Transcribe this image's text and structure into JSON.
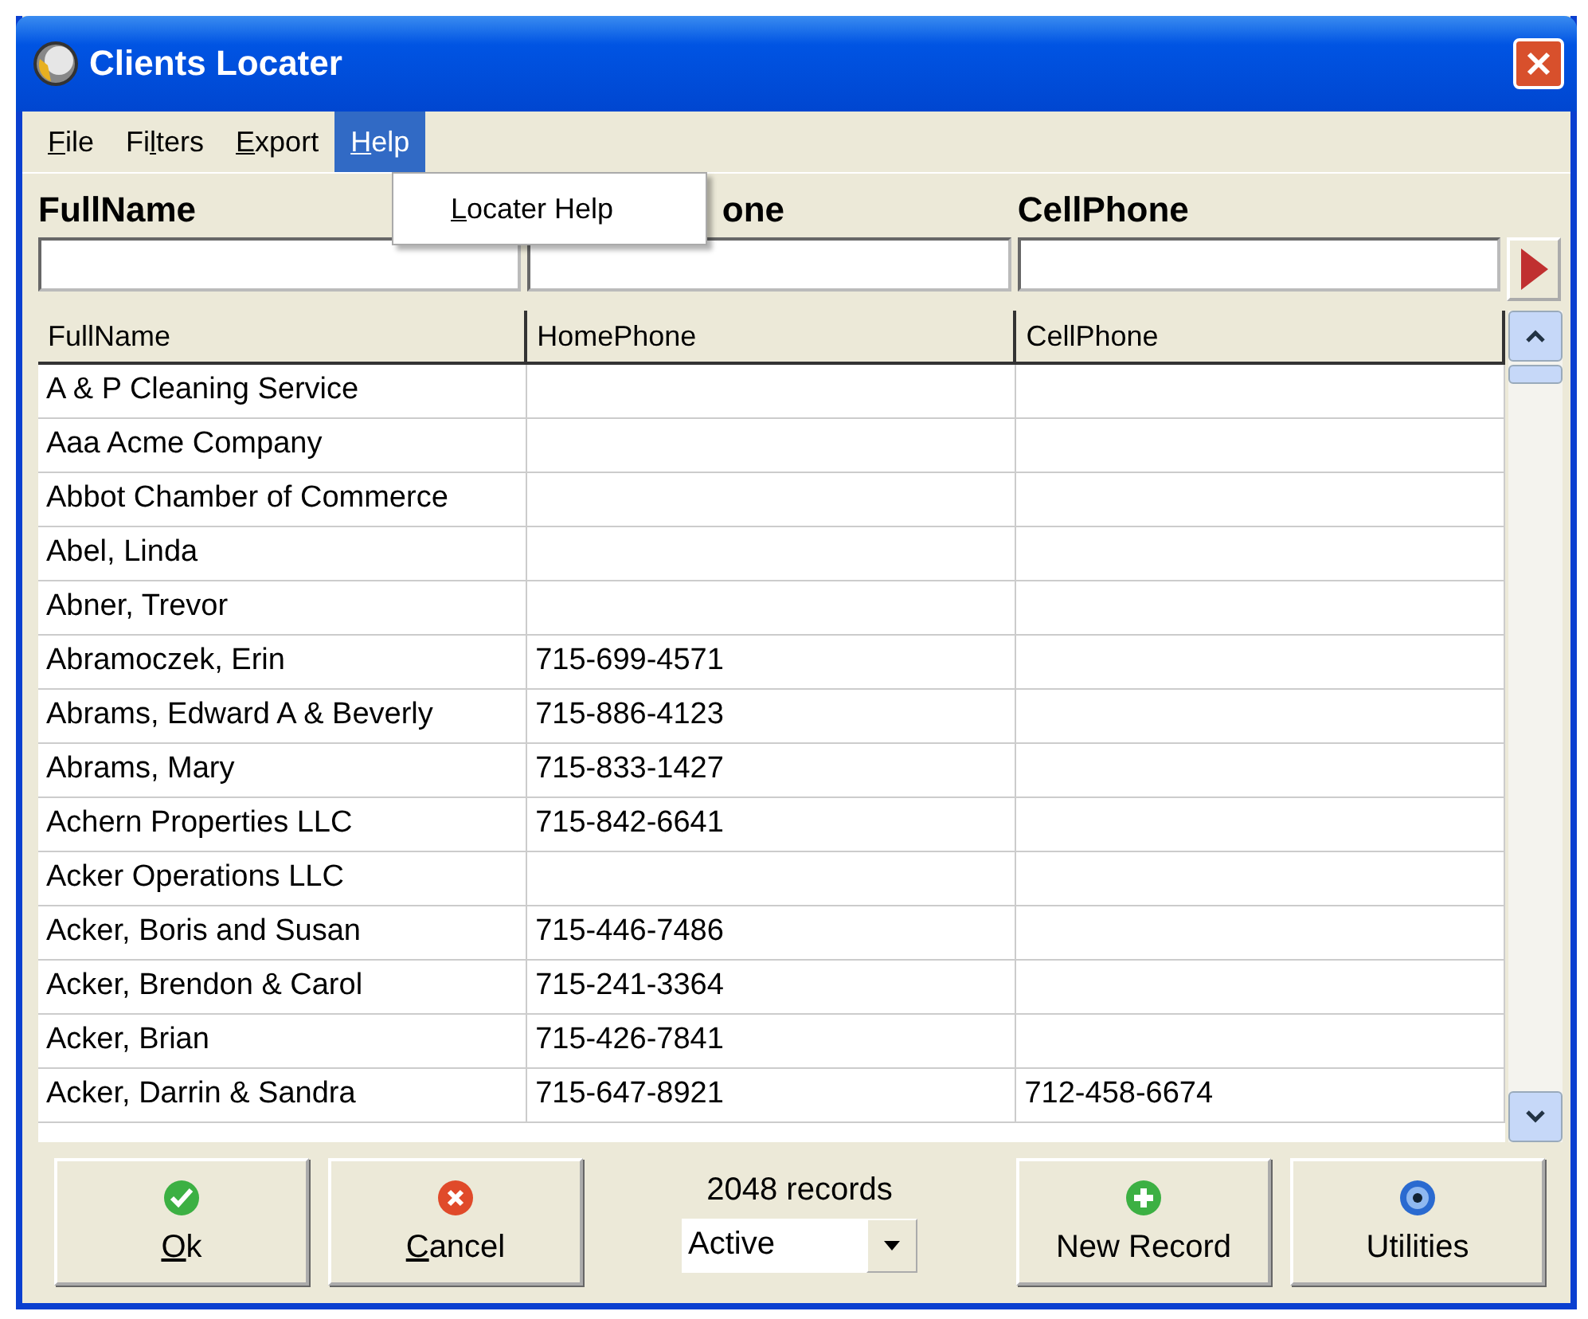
{
  "window": {
    "title": "Clients Locater"
  },
  "menu": [
    {
      "parts": {
        "key": "F",
        "post": "ile"
      },
      "selected": false
    },
    {
      "parts": {
        "pre": "Fi",
        "key": "l",
        "post": "ters"
      },
      "selected": false
    },
    {
      "parts": {
        "key": "E",
        "post": "xport"
      },
      "selected": false
    },
    {
      "parts": {
        "key": "H",
        "post": "elp"
      },
      "selected": true
    }
  ],
  "open_menu": {
    "items": [
      {
        "parts": {
          "key": "L",
          "post": "ocater Help"
        }
      }
    ]
  },
  "filters": [
    {
      "label": "FullName"
    },
    {
      "label": "one"
    },
    {
      "label": "CellPhone"
    }
  ],
  "table": {
    "columns": [
      "FullName",
      "HomePhone",
      "CellPhone"
    ],
    "rows": [
      [
        "A & P Cleaning Service",
        "",
        ""
      ],
      [
        "Aaa Acme Company",
        "",
        ""
      ],
      [
        "Abbot Chamber of Commerce",
        "",
        ""
      ],
      [
        "Abel, Linda",
        "",
        ""
      ],
      [
        "Abner, Trevor",
        "",
        ""
      ],
      [
        "Abramoczek, Erin",
        "715-699-4571",
        ""
      ],
      [
        "Abrams, Edward A & Beverly",
        "715-886-4123",
        ""
      ],
      [
        "Abrams, Mary",
        "715-833-1427",
        ""
      ],
      [
        "Achern Properties LLC",
        "715-842-6641",
        ""
      ],
      [
        "Acker Operations LLC",
        "",
        ""
      ],
      [
        "Acker, Boris and Susan",
        "715-446-7486",
        ""
      ],
      [
        "Acker, Brendon & Carol",
        "715-241-3364",
        ""
      ],
      [
        "Acker, Brian",
        "715-426-7841",
        ""
      ],
      [
        "Acker, Darrin & Sandra",
        "715-647-8921",
        "712-458-6674"
      ]
    ]
  },
  "footer": {
    "buttons_left": [
      {
        "kind": "ok",
        "parts": {
          "key": "O",
          "post": "k"
        }
      },
      {
        "kind": "cancel",
        "parts": {
          "key": "C",
          "post": "ancel"
        }
      }
    ],
    "record_count": "2048 records",
    "status_select": "Active",
    "buttons_right": [
      {
        "kind": "new",
        "parts": {
          "pre": "New Record"
        }
      },
      {
        "kind": "utilities",
        "parts": {
          "pre": "Utilities"
        }
      }
    ]
  }
}
